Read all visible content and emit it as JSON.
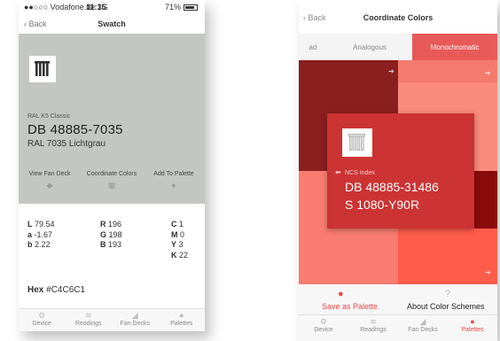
{
  "swatch_screen": {
    "status": {
      "carrier": "●●○○○ Vodafone.de 3G",
      "time": "11:15",
      "battery": "71%"
    },
    "nav": {
      "back": "Back",
      "title": "Swatch"
    },
    "swatch": {
      "subtitle": "RAL K5 Classic",
      "code": "DB 48885-7035",
      "name": "RAL 7035 Lichtgrau",
      "color": "#C4C6C1"
    },
    "actions": [
      {
        "label": "View Fan Deck",
        "icon": "fan-deck-icon",
        "glyph": "◆"
      },
      {
        "label": "Coordinate Colors",
        "icon": "grid-icon",
        "glyph": "▦"
      },
      {
        "label": "Add To Palette",
        "icon": "palette-icon",
        "glyph": "●"
      }
    ],
    "lab": [
      {
        "k": "L",
        "v": "79.54"
      },
      {
        "k": "a",
        "v": "-1.67"
      },
      {
        "k": "b",
        "v": "2.22"
      }
    ],
    "rgb": [
      {
        "k": "R",
        "v": "196"
      },
      {
        "k": "G",
        "v": "198"
      },
      {
        "k": "B",
        "v": "193"
      }
    ],
    "cmyk": [
      {
        "k": "C",
        "v": "1"
      },
      {
        "k": "M",
        "v": "0"
      },
      {
        "k": "Y",
        "v": "3"
      },
      {
        "k": "K",
        "v": "22"
      }
    ],
    "hex_label": "Hex",
    "hex_value": "#C4C6C1",
    "tabs": [
      {
        "label": "Device",
        "glyph": "⚙"
      },
      {
        "label": "Readings",
        "glyph": "≋"
      },
      {
        "label": "Fan Decks",
        "glyph": "◢"
      },
      {
        "label": "Palettes",
        "glyph": "●"
      }
    ]
  },
  "coordinate_screen": {
    "nav": {
      "back": "Back",
      "title": "Coordinate Colors"
    },
    "segments": [
      {
        "label": "ad",
        "active": false
      },
      {
        "label": "Analogous",
        "active": false
      },
      {
        "label": "Monochromatic",
        "active": true
      }
    ],
    "tiles": [
      {
        "color": "#8B1E1E"
      },
      {
        "color": "#F57A6E"
      },
      {
        "color": "#FA8A7A"
      },
      {
        "color": "#F97C70"
      },
      {
        "color": "#F57068"
      },
      {
        "color": "#8B0A0A"
      },
      {
        "color": "#FF5C4C"
      }
    ],
    "card": {
      "subtitle": "NCS Index",
      "code": "DB 48885-31486",
      "name": "S 1080-Y90R",
      "color": "#CC3333"
    },
    "save_label": "Save as Palette",
    "about_label": "About Color Schemes",
    "tabs": [
      {
        "label": "Device",
        "glyph": "⚙",
        "active": false
      },
      {
        "label": "Readings",
        "glyph": "≋",
        "active": false
      },
      {
        "label": "Fan Decks",
        "glyph": "◢",
        "active": false
      },
      {
        "label": "Palettes",
        "glyph": "●",
        "active": true
      }
    ]
  }
}
